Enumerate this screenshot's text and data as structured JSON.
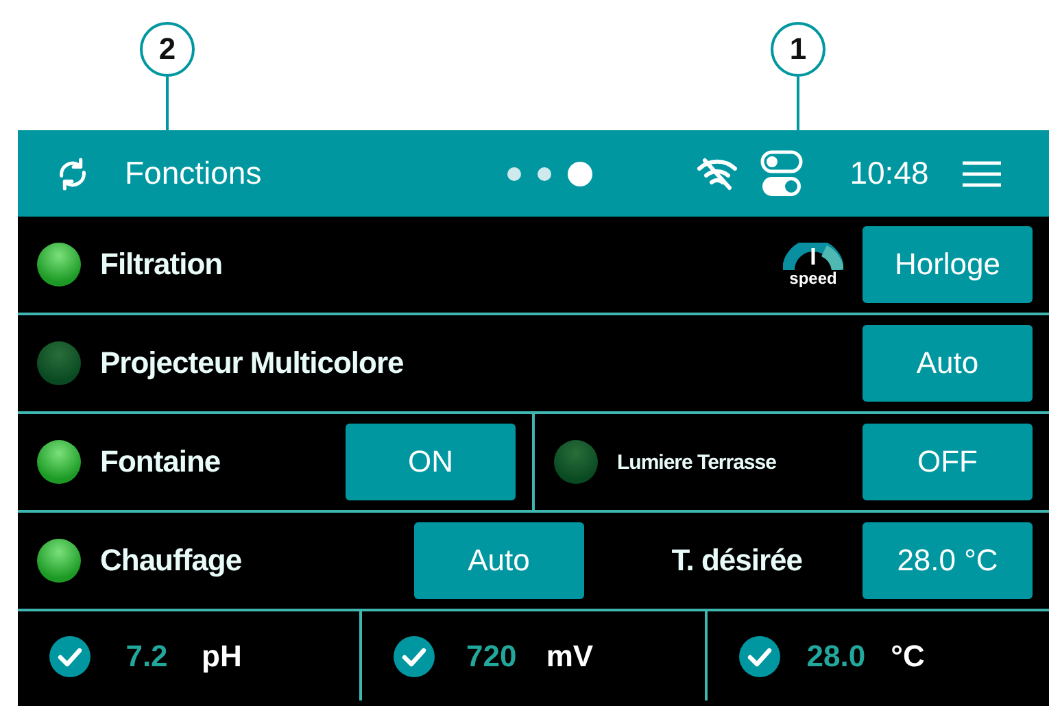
{
  "callouts": [
    {
      "label": "2"
    },
    {
      "label": "1"
    }
  ],
  "header": {
    "title": "Fonctions",
    "pages": [
      {
        "selected": false
      },
      {
        "selected": false
      },
      {
        "selected": true
      }
    ],
    "time": "10:48"
  },
  "rows": [
    {
      "kind": "wide",
      "items": [
        {
          "label": "Filtration",
          "lit": true,
          "speed_badge": "speed",
          "button": "Horloge"
        }
      ]
    },
    {
      "kind": "wide",
      "items": [
        {
          "label": "Projecteur Multicolore",
          "lit": false,
          "button": "Auto"
        }
      ]
    },
    {
      "kind": "split",
      "items": [
        {
          "label": "Fontaine",
          "lit": true,
          "button": "ON"
        },
        {
          "label": "Lumiere Terrasse",
          "lit": false,
          "small": true,
          "button": "OFF"
        }
      ]
    },
    {
      "kind": "setpoint",
      "items": [
        {
          "label": "Chauffage",
          "lit": true,
          "button": "Auto",
          "setpoint_label": "T. désirée",
          "setpoint_value": "28.0 °C"
        }
      ]
    }
  ],
  "readings": [
    {
      "value": "7.2",
      "unit": "pH"
    },
    {
      "value": "720",
      "unit": "mV"
    },
    {
      "value": "28.0",
      "unit": "°C"
    }
  ]
}
